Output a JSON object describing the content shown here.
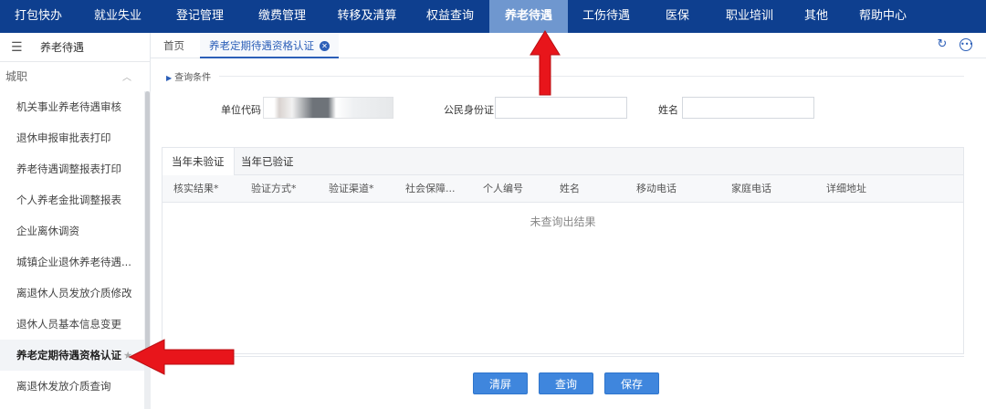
{
  "topnav": {
    "items": [
      {
        "label": "打包快办"
      },
      {
        "label": "就业失业"
      },
      {
        "label": "登记管理"
      },
      {
        "label": "缴费管理"
      },
      {
        "label": "转移及清算"
      },
      {
        "label": "权益查询"
      },
      {
        "label": "养老待遇",
        "active": true
      },
      {
        "label": "工伤待遇"
      },
      {
        "label": "医保"
      },
      {
        "label": "职业培训"
      },
      {
        "label": "其他"
      },
      {
        "label": "帮助中心"
      }
    ]
  },
  "sidebar": {
    "title": "养老待遇",
    "group": "城职",
    "items": [
      {
        "label": "机关事业养老待遇审核"
      },
      {
        "label": "退休申报审批表打印"
      },
      {
        "label": "养老待遇调整报表打印"
      },
      {
        "label": "个人养老金批调整报表"
      },
      {
        "label": "企业离休调资"
      },
      {
        "label": "城镇企业退休养老待遇..."
      },
      {
        "label": "离退休人员发放介质修改"
      },
      {
        "label": "退休人员基本信息变更"
      },
      {
        "label": "养老定期待遇资格认证",
        "active": true
      },
      {
        "label": "离退休发放介质查询"
      }
    ]
  },
  "tabs": {
    "home": "首页",
    "active": "养老定期待遇资格认证"
  },
  "query": {
    "title": "查询条件",
    "unit_code_label": "单位代码",
    "id_label": "公民身份证",
    "name_label": "姓名",
    "id_value": "",
    "name_value": ""
  },
  "result": {
    "tab_unverified": "当年未验证",
    "tab_verified": "当年已验证",
    "columns": [
      "核实结果*",
      "验证方式*",
      "验证渠道*",
      "社会保障...",
      "个人编号",
      "姓名",
      "移动电话",
      "家庭电话",
      "详细地址"
    ],
    "empty_text": "未查询出结果"
  },
  "buttons": {
    "clear": "清屏",
    "query": "查询",
    "save": "保存"
  },
  "colors": {
    "nav_bg": "#0e3f8f",
    "nav_active": "#6f97cf",
    "button": "#3f86dd",
    "arrow": "#e8151b"
  }
}
